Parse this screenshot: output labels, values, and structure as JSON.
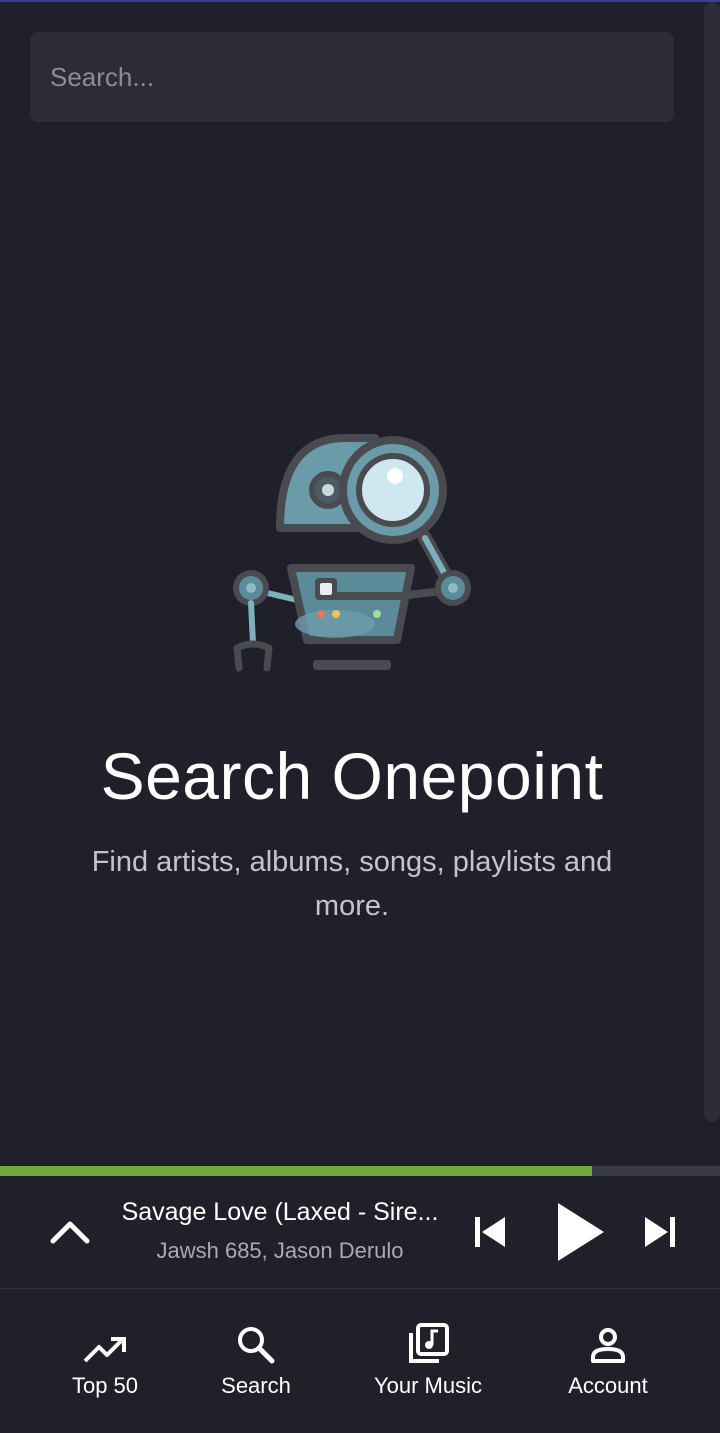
{
  "search": {
    "placeholder": "Search..."
  },
  "hero": {
    "illustration": "robot-magnifier-icon",
    "title": "Search Onepoint",
    "subtitle": "Find artists, albums, songs, playlists and more."
  },
  "player": {
    "progress_fraction": 0.822,
    "track_title": "Savage Love (Laxed - Sire...",
    "track_artist": "Jawsh 685, Jason Derulo",
    "icons": [
      "chevron-up-icon",
      "skip-previous-icon",
      "play-icon",
      "skip-next-icon"
    ]
  },
  "nav": {
    "items": [
      {
        "label": "Top 50",
        "icon": "trending-up-icon"
      },
      {
        "label": "Search",
        "icon": "search-icon"
      },
      {
        "label": "Your Music",
        "icon": "music-library-icon"
      },
      {
        "label": "Account",
        "icon": "account-icon"
      }
    ]
  },
  "colors": {
    "background": "#1f2029",
    "input_bg": "#2b2c36",
    "progress": "#6da840",
    "text": "#ffffff",
    "muted": "#a9aab3"
  }
}
